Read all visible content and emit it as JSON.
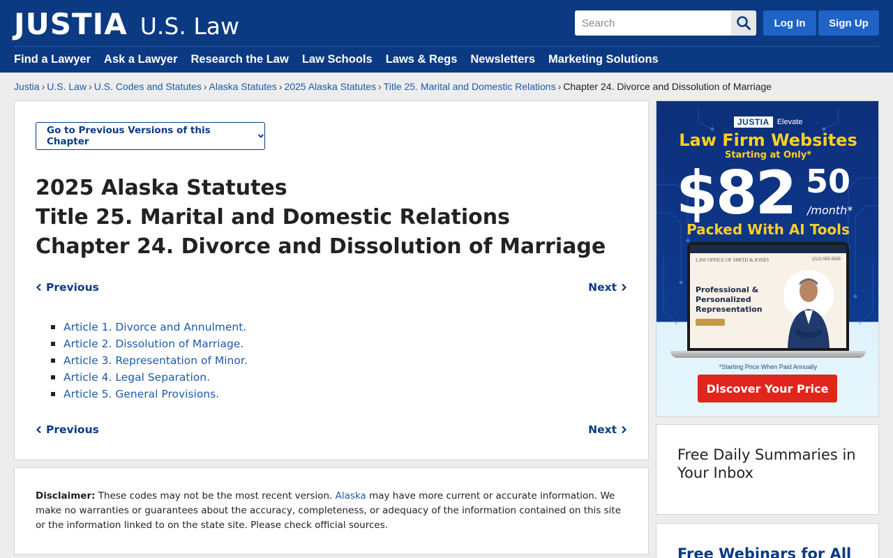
{
  "header": {
    "logo_main": "JUSTIA",
    "logo_sub": "U.S. Law",
    "search_placeholder": "Search",
    "login_label": "Log In",
    "signup_label": "Sign Up",
    "nav": [
      "Find a Lawyer",
      "Ask a Lawyer",
      "Research the Law",
      "Law Schools",
      "Laws & Regs",
      "Newsletters",
      "Marketing Solutions"
    ]
  },
  "breadcrumb": {
    "links": [
      "Justia",
      "U.S. Law",
      "U.S. Codes and Statutes",
      "Alaska Statutes",
      "2025 Alaska Statutes",
      "Title 25. Marital and Domestic Relations"
    ],
    "current": "Chapter 24. Divorce and Dissolution of Marriage"
  },
  "main": {
    "versions_label": "Go to Previous Versions of this Chapter",
    "title_lines": [
      "2025 Alaska Statutes",
      "Title 25. Marital and Domestic Relations",
      "Chapter 24. Divorce and Dissolution of Marriage"
    ],
    "prev_label": "Previous",
    "next_label": "Next",
    "articles": [
      "Article 1. Divorce and Annulment.",
      "Article 2. Dissolution of Marriage.",
      "Article 3. Representation of Minor.",
      "Article 4. Legal Separation.",
      "Article 5. General Provisions."
    ]
  },
  "disclaimer": {
    "label": "Disclaimer:",
    "text_before": " These codes may not be the most recent version. ",
    "link": "Alaska",
    "text_after": " may have more current or accurate information. We make no warranties or guarantees about the accuracy, completeness, or adequacy of the information contained on this site or the information linked to on the state site. Please check official sources."
  },
  "ad": {
    "brand": "JUSTIA",
    "brand_sub": "Elevate",
    "headline": "Law Firm Websites",
    "subline": "Starting at Only*",
    "price_main": "$82",
    "price_cents": "50",
    "price_unit": "/month*",
    "tools": "Packed With AI Tools",
    "screen_firm": "LAW OFFICE OF SMITH & JONES",
    "screen_phone": "(212) 555-5555",
    "screen_headline": "Professional & Personalized Representation",
    "note": "*Starting Price When Paid Annually",
    "cta": "Discover Your Price"
  },
  "sidebar": {
    "card1_title": "Free Daily Summaries in Your Inbox",
    "card2_title": "Free Webinars for All"
  },
  "colors": {
    "header_bg": "#0b3a82",
    "link": "#1d5ba8",
    "button_blue": "#1f63c7",
    "cta_red": "#e0261c",
    "ad_yellow": "#ffcf24"
  }
}
